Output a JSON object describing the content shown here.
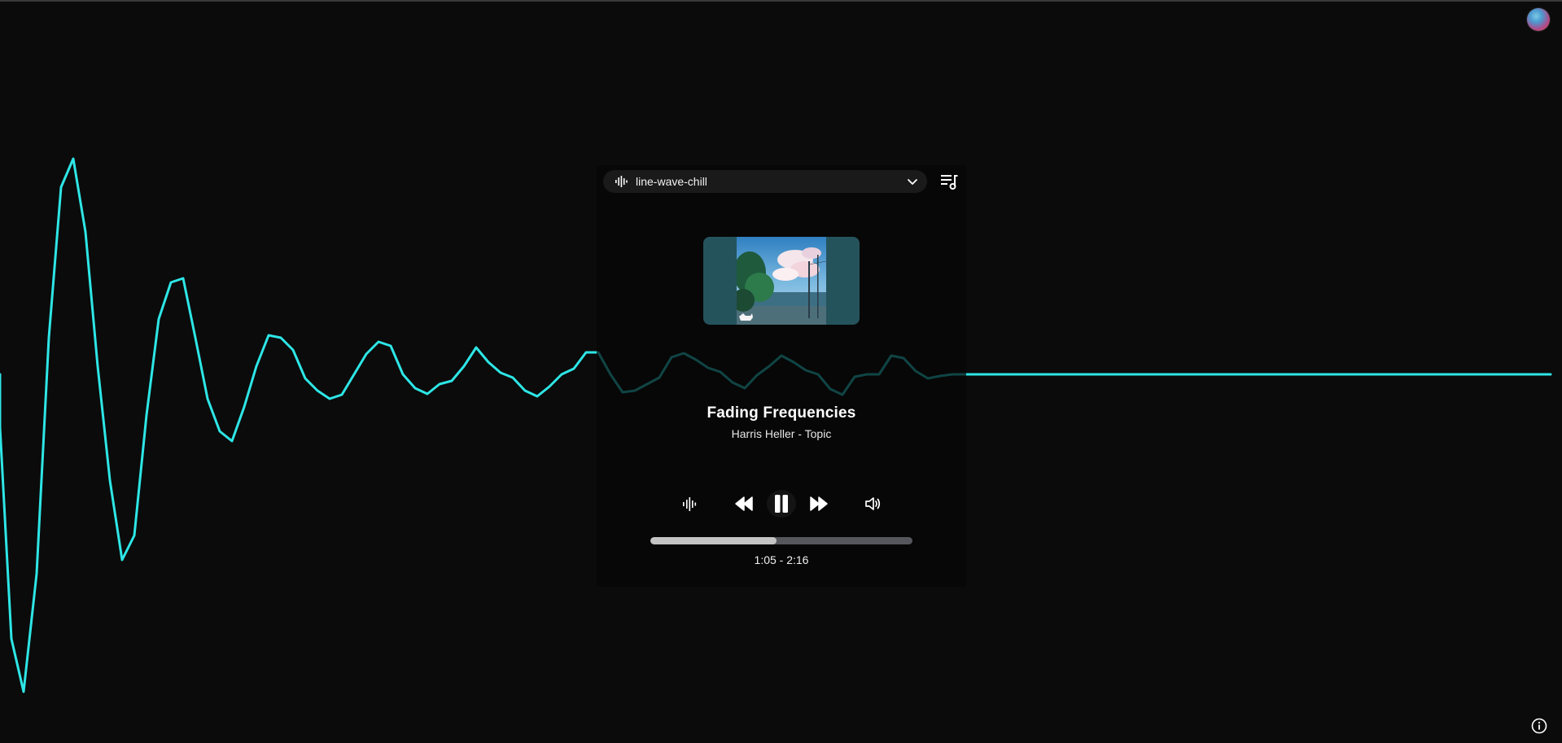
{
  "app": {
    "accent_color": "#2ee6e6",
    "background_color": "#0b0b0b"
  },
  "visualizer": {
    "preset_name": "line-wave-chill",
    "icon": "audio-wave-icon"
  },
  "header": {
    "selector_dropdown_icon": "chevron-down-icon",
    "queue_icon": "playlist-icon"
  },
  "track": {
    "title": "Fading Frequencies",
    "artist": "Harris Heller - Topic",
    "current_time": "1:05",
    "duration": "2:16",
    "time_display": "1:05 - 2:16",
    "progress": 0.48
  },
  "controls": {
    "visualizer_icon": "audio-wave-icon",
    "previous_icon": "rewind-icon",
    "play_pause_icon": "pause-icon",
    "next_icon": "fast-forward-icon",
    "volume_icon": "volume-icon"
  },
  "corner": {
    "avatar_icon": "avatar",
    "info_icon": "info-icon"
  }
}
